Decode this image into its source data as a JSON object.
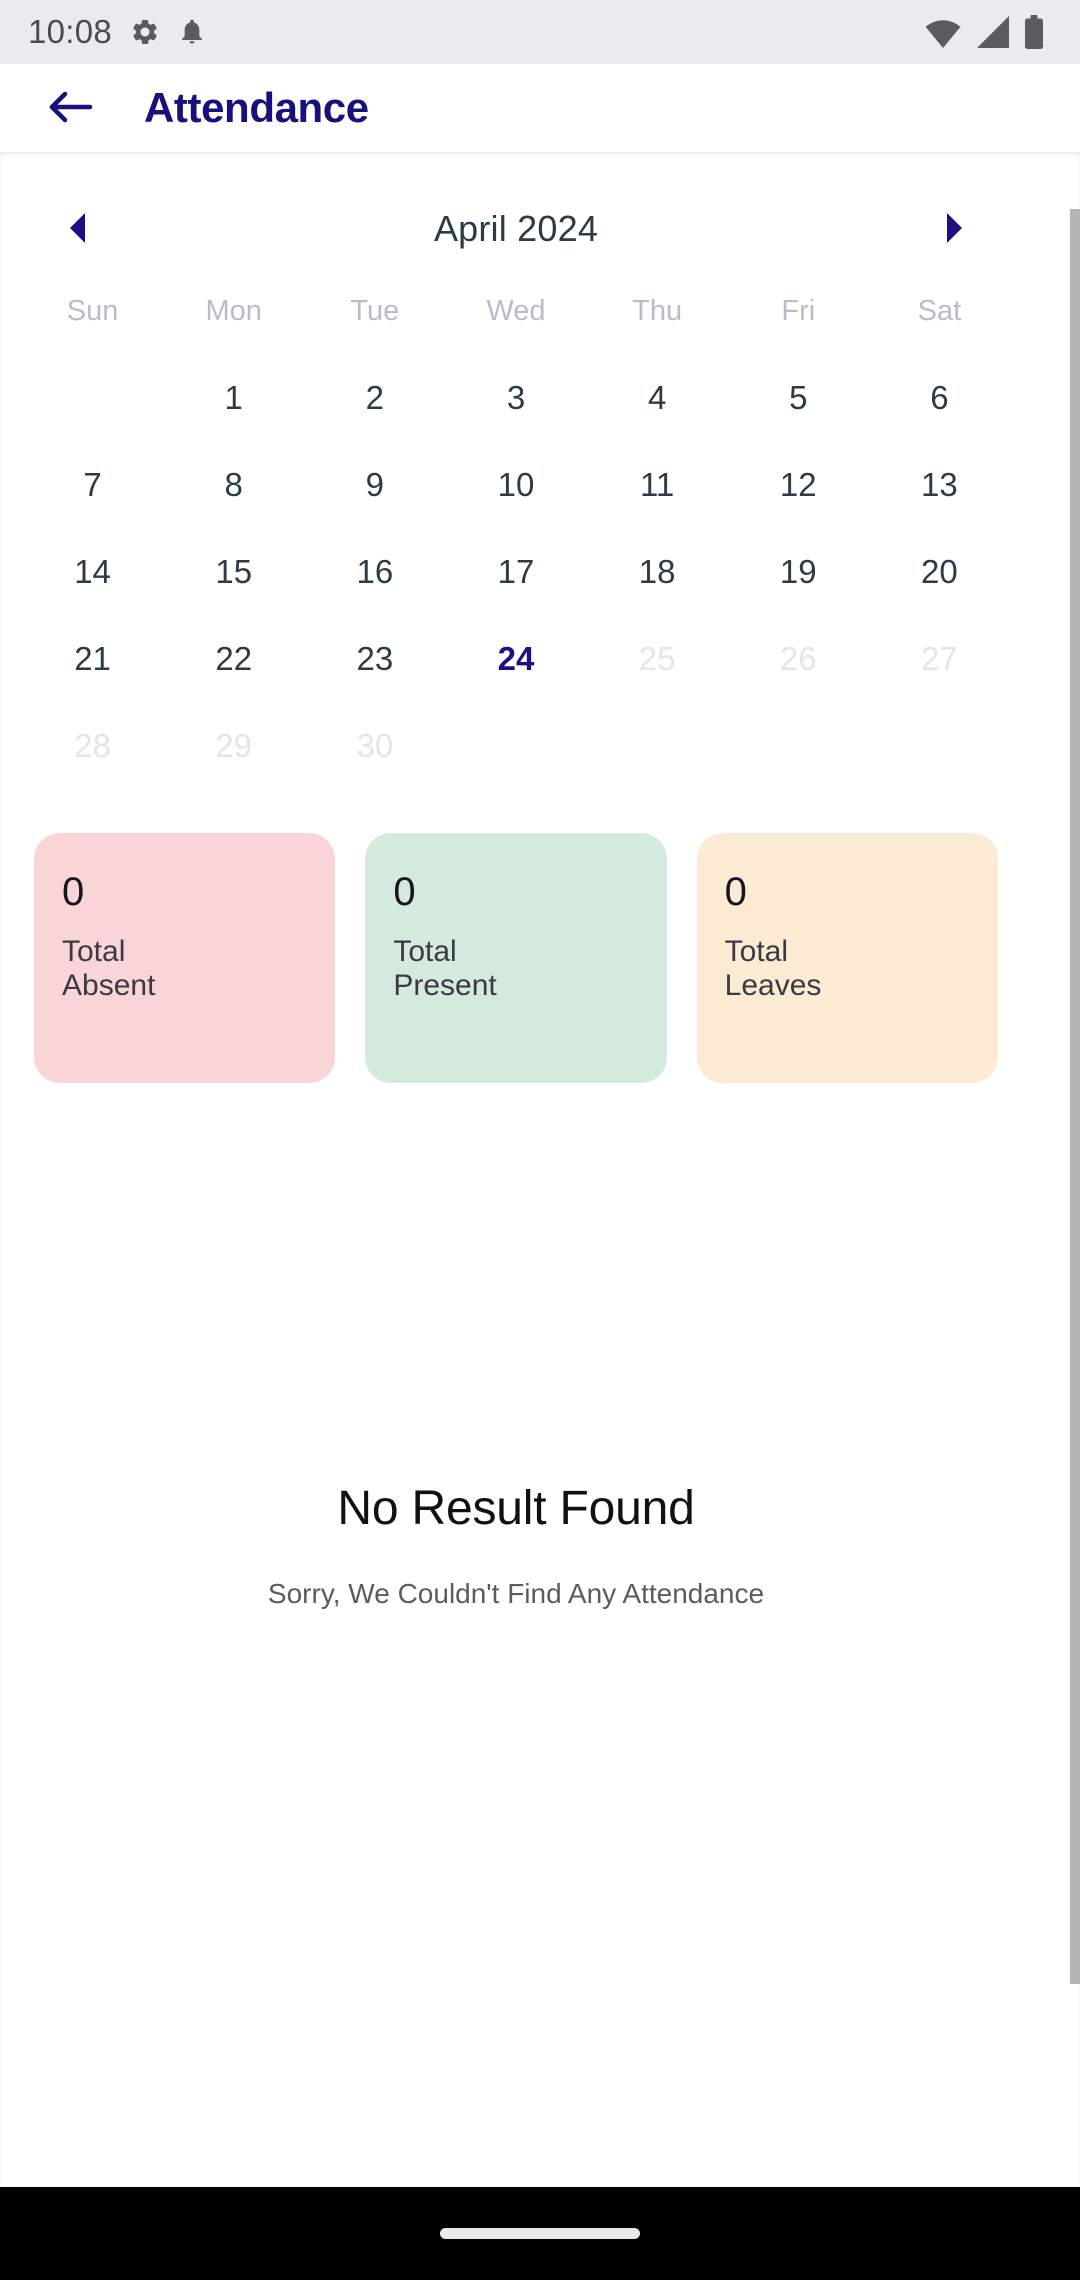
{
  "status_bar": {
    "time": "10:08",
    "left_icons": [
      "gear-icon",
      "bell-icon"
    ],
    "right_icons": [
      "wifi-icon",
      "cellular-signal-icon",
      "battery-icon"
    ],
    "background": "#EBEBEF"
  },
  "app_bar": {
    "back_icon": "arrow-left-icon",
    "title": "Attendance",
    "title_color": "#18107C"
  },
  "calendar": {
    "prev_icon": "chevron-left-icon",
    "next_icon": "chevron-right-icon",
    "month_label": "April 2024",
    "weekdays": [
      "Sun",
      "Mon",
      "Tue",
      "Wed",
      "Thu",
      "Fri",
      "Sat"
    ],
    "leading_blanks": 1,
    "days": [
      {
        "n": "1",
        "state": "normal"
      },
      {
        "n": "2",
        "state": "normal"
      },
      {
        "n": "3",
        "state": "normal"
      },
      {
        "n": "4",
        "state": "normal"
      },
      {
        "n": "5",
        "state": "normal"
      },
      {
        "n": "6",
        "state": "normal"
      },
      {
        "n": "7",
        "state": "normal"
      },
      {
        "n": "8",
        "state": "normal"
      },
      {
        "n": "9",
        "state": "normal"
      },
      {
        "n": "10",
        "state": "normal"
      },
      {
        "n": "11",
        "state": "normal"
      },
      {
        "n": "12",
        "state": "normal"
      },
      {
        "n": "13",
        "state": "normal"
      },
      {
        "n": "14",
        "state": "normal"
      },
      {
        "n": "15",
        "state": "normal"
      },
      {
        "n": "16",
        "state": "normal"
      },
      {
        "n": "17",
        "state": "normal"
      },
      {
        "n": "18",
        "state": "normal"
      },
      {
        "n": "19",
        "state": "normal"
      },
      {
        "n": "20",
        "state": "normal"
      },
      {
        "n": "21",
        "state": "normal"
      },
      {
        "n": "22",
        "state": "normal"
      },
      {
        "n": "23",
        "state": "normal"
      },
      {
        "n": "24",
        "state": "today"
      },
      {
        "n": "25",
        "state": "muted"
      },
      {
        "n": "26",
        "state": "muted"
      },
      {
        "n": "27",
        "state": "muted"
      },
      {
        "n": "28",
        "state": "muted"
      },
      {
        "n": "29",
        "state": "muted"
      },
      {
        "n": "30",
        "state": "muted"
      }
    ],
    "selected_day": "24",
    "day_color": "#2B3B48",
    "muted_color": "#E2E5EA",
    "today_color": "#1D0F86",
    "weekday_color": "#B6BDCB"
  },
  "stats": [
    {
      "value": "0",
      "label": "Total\nAbsent",
      "bg": "#F9D5D8"
    },
    {
      "value": "0",
      "label": "Total\nPresent",
      "bg": "#D4EADD"
    },
    {
      "value": "0",
      "label": "Total\nLeaves",
      "bg": "#FBEBD3"
    }
  ],
  "empty_state": {
    "title": "No Result Found",
    "subtitle": "Sorry, We Couldn't Find Any Attendance"
  },
  "nav_bar": {
    "home_indicator": "home-indicator-pill",
    "background": "#000000"
  }
}
